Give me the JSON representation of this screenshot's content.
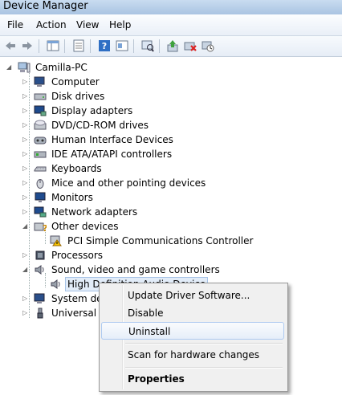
{
  "window": {
    "title": "Device Manager"
  },
  "menu": [
    "File",
    "Action",
    "View",
    "Help"
  ],
  "toolbar": {
    "icons": [
      "back-arrow-icon",
      "forward-arrow-icon",
      "show-hide-tree-icon",
      "properties-icon",
      "help-icon",
      "view-icon",
      "scan-hardware-icon",
      "update-driver-icon",
      "uninstall-icon",
      "disable-icon"
    ]
  },
  "tree": {
    "root": "Camilla-PC",
    "items": [
      {
        "label": "Computer",
        "icon": "computer-icon"
      },
      {
        "label": "Disk drives",
        "icon": "disk-drive-icon"
      },
      {
        "label": "Display adapters",
        "icon": "display-adapter-icon"
      },
      {
        "label": "DVD/CD-ROM drives",
        "icon": "dvd-drive-icon"
      },
      {
        "label": "Human Interface Devices",
        "icon": "hid-icon"
      },
      {
        "label": "IDE ATA/ATAPI controllers",
        "icon": "ide-controller-icon"
      },
      {
        "label": "Keyboards",
        "icon": "keyboard-icon"
      },
      {
        "label": "Mice and other pointing devices",
        "icon": "mouse-icon"
      },
      {
        "label": "Monitors",
        "icon": "monitor-icon"
      },
      {
        "label": "Network adapters",
        "icon": "network-adapter-icon"
      },
      {
        "label": "Other devices",
        "icon": "unknown-device-icon"
      },
      {
        "label": "PCI Simple Communications Controller",
        "icon": "warning-device-icon"
      },
      {
        "label": "Processors",
        "icon": "processor-icon"
      },
      {
        "label": "Sound, video and game controllers",
        "icon": "speaker-icon"
      },
      {
        "label": "High Definition Audio Device",
        "icon": "audio-device-icon"
      },
      {
        "label": "System dev",
        "icon": "system-device-icon"
      },
      {
        "label": "Universal Se",
        "icon": "usb-icon"
      }
    ]
  },
  "context_menu": {
    "items": [
      "Update Driver Software...",
      "Disable",
      "Uninstall",
      "Scan for hardware changes",
      "Properties"
    ]
  }
}
